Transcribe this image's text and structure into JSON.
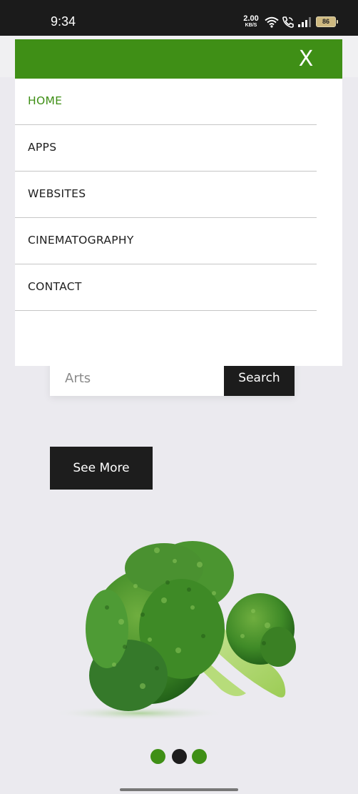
{
  "status_bar": {
    "time": "9:34",
    "net_speed_value": "2.00",
    "net_speed_unit": "KB/S",
    "battery_level": "86"
  },
  "search": {
    "placeholder": "Arts",
    "button_label": "Search"
  },
  "see_more_label": "See More",
  "menu": {
    "close_label": "X",
    "items": [
      {
        "label": "HOME",
        "active": true
      },
      {
        "label": "APPS",
        "active": false
      },
      {
        "label": "WEBSITES",
        "active": false
      },
      {
        "label": "CINEMATOGRAPHY",
        "active": false
      },
      {
        "label": "CONTACT",
        "active": false
      }
    ]
  },
  "carousel": {
    "active_index": 1,
    "count": 3,
    "dot_color": "#3f8f16",
    "active_dot_color": "#1d1d1d"
  },
  "colors": {
    "brand_green": "#3f8f16",
    "dark": "#1d1d1d",
    "background": "#ebeaef"
  },
  "icons": [
    "wifi-icon",
    "call-icon",
    "signal-icon",
    "battery-icon",
    "close-icon",
    "broccoli-image"
  ]
}
